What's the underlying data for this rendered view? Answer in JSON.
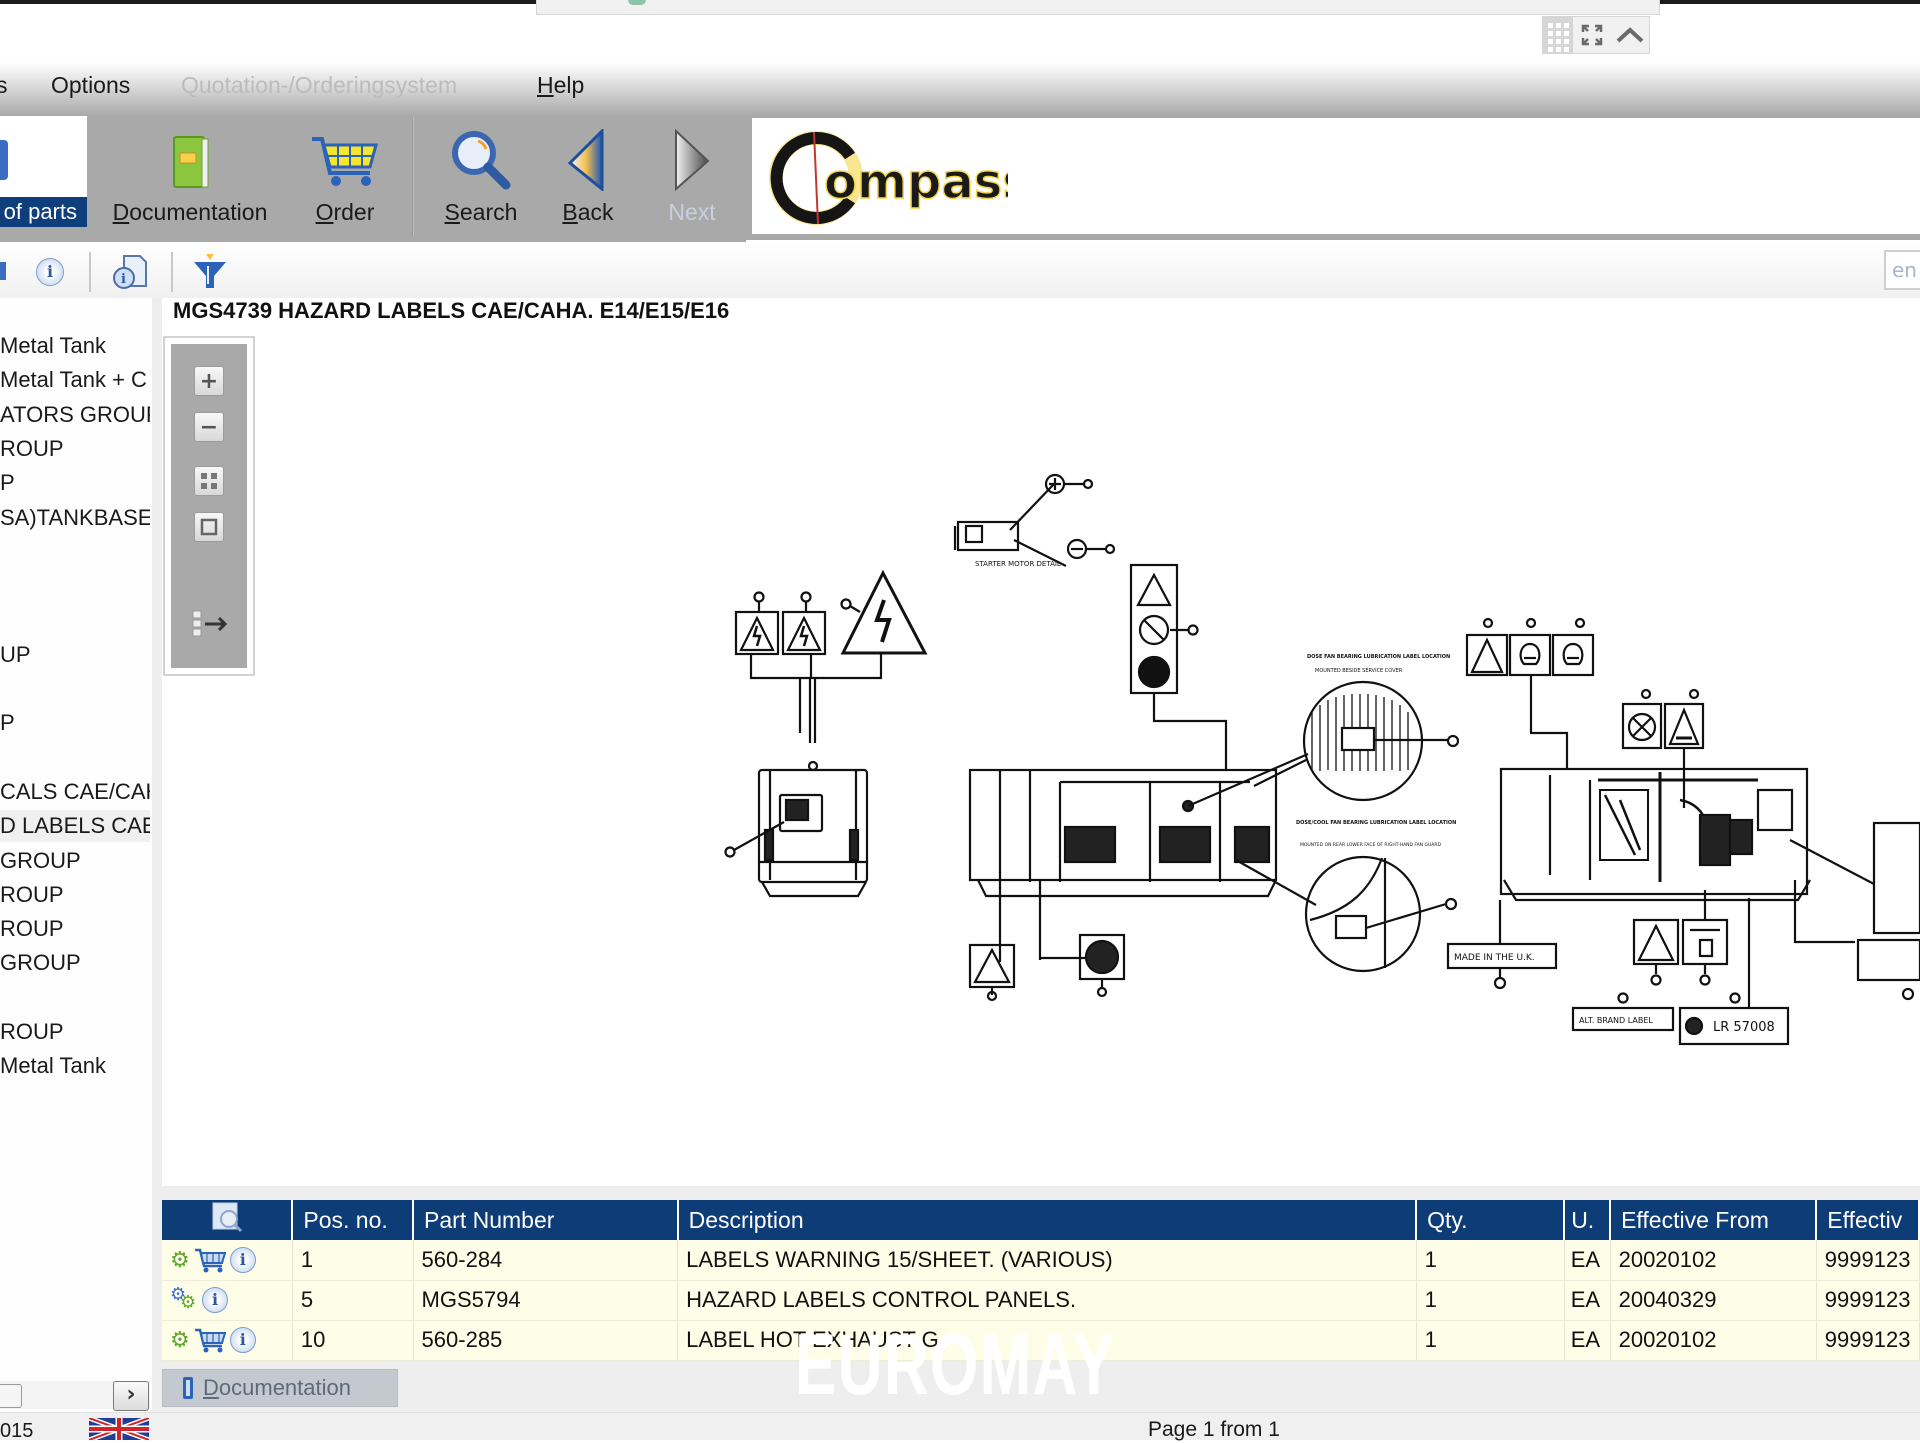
{
  "window": {
    "controls": {
      "grid_icon": "grid-icon",
      "fullscreen_icon": "expand-icon",
      "collapse_icon": "chevron-up-icon"
    }
  },
  "menu": {
    "items": [
      {
        "label": "s",
        "enabled": true
      },
      {
        "label": "Options",
        "enabled": true
      },
      {
        "label": "Quotation-/Orderingsystem",
        "enabled": false
      },
      {
        "label": "Help",
        "enabled": true,
        "mnemonic": "H"
      }
    ]
  },
  "toolbar": {
    "parts_label": "of parts",
    "buttons": [
      {
        "label": "Documentation",
        "icon": "book-icon",
        "enabled": true
      },
      {
        "label": "Order",
        "icon": "cart-icon",
        "enabled": true
      },
      {
        "label": "Search",
        "icon": "magnifier-icon",
        "enabled": true
      },
      {
        "label": "Back",
        "icon": "arrow-left-icon",
        "enabled": true
      },
      {
        "label": "Next",
        "icon": "arrow-right-icon",
        "enabled": false
      }
    ],
    "logo_text": "ompass",
    "logo_letter": "C"
  },
  "subtoolbar": {
    "icons": [
      "info-icon",
      "document-info-icon",
      "filter-icon"
    ],
    "language_input": "en"
  },
  "tree": {
    "items": [
      {
        "label": "Metal Tank",
        "selected": false
      },
      {
        "label": "Metal Tank + C",
        "selected": false
      },
      {
        "label": "ATORS GROUP",
        "selected": false
      },
      {
        "label": "ROUP",
        "selected": false
      },
      {
        "label": "P",
        "selected": false
      },
      {
        "label": "SA)TANKBASE.",
        "selected": false
      },
      {
        "label": "",
        "selected": false
      },
      {
        "label": "",
        "selected": false
      },
      {
        "label": "",
        "selected": false
      },
      {
        "label": "UP",
        "selected": false
      },
      {
        "label": "",
        "selected": false
      },
      {
        "label": "P",
        "selected": false
      },
      {
        "label": "",
        "selected": false
      },
      {
        "label": "CALS CAE/CAH",
        "selected": false
      },
      {
        "label": "D LABELS CAE/",
        "selected": true
      },
      {
        "label": "GROUP",
        "selected": false
      },
      {
        "label": "ROUP",
        "selected": false
      },
      {
        "label": "ROUP",
        "selected": false
      },
      {
        "label": "GROUP",
        "selected": false
      },
      {
        "label": "",
        "selected": false
      },
      {
        "label": "ROUP",
        "selected": false
      },
      {
        "label": "Metal Tank",
        "selected": false
      }
    ]
  },
  "drawing": {
    "title": "MGS4739 HAZARD LABELS CAE/CAHA. E14/E15/E16",
    "tools": [
      "zoom-in-icon",
      "zoom-out-icon",
      "fit-all-icon",
      "fit-window-icon",
      "export-list-icon"
    ],
    "labels": {
      "starter": "STARTER MOTOR DETAIL",
      "made_in": "MADE IN THE U.K.",
      "alt_brand": "ALT. BRAND LABEL",
      "lr": "LR 57008",
      "bearing1_title": "DOSE FAN BEARING LUBRICATION LABEL LOCATION",
      "bearing1_sub": "MOUNTED BESIDE SERVICE COVER",
      "bearing2_title": "DOSE/COOL FAN BEARING LUBRICATION LABEL LOCATION",
      "bearing2_sub": "MOUNTED ON REAR LOWER FACE OF RIGHT-HAND FAN GUARD"
    }
  },
  "parts_table": {
    "columns": [
      "",
      "Pos. no.",
      "Part Number",
      "Description",
      "Qty.",
      "U.",
      "Effective From",
      "Effectiv"
    ],
    "rows": [
      {
        "icons": [
          "gear-icon",
          "cart-icon",
          "info-icon"
        ],
        "pos": "1",
        "part_number": "560-284",
        "description": "LABELS WARNING 15/SHEET. (VARIOUS)",
        "qty": "1",
        "unit": "EA",
        "effective_from": "20020102",
        "effective_to": "9999123"
      },
      {
        "icons": [
          "gears-icon",
          "info-icon"
        ],
        "pos": "5",
        "part_number": "MGS5794",
        "description": "HAZARD LABELS CONTROL PANELS.",
        "qty": "1",
        "unit": "EA",
        "effective_from": "20040329",
        "effective_to": "9999123"
      },
      {
        "icons": [
          "gear-icon",
          "cart-icon",
          "info-icon"
        ],
        "pos": "10",
        "part_number": "560-285",
        "description": "LABEL HOT EXHAUST G.",
        "qty": "1",
        "unit": "EA",
        "effective_from": "20020102",
        "effective_to": "9999123"
      }
    ],
    "documentation_button": "Documentation"
  },
  "watermark": "EUROMAY",
  "status": {
    "year_fragment": "015",
    "language_flag": "uk-flag-icon",
    "page_text": "Page 1 from 1"
  },
  "colors": {
    "header_blue": "#0e3c76",
    "row_yellow": "#fefee8",
    "toolbar_gray": "#a9a9a9"
  }
}
